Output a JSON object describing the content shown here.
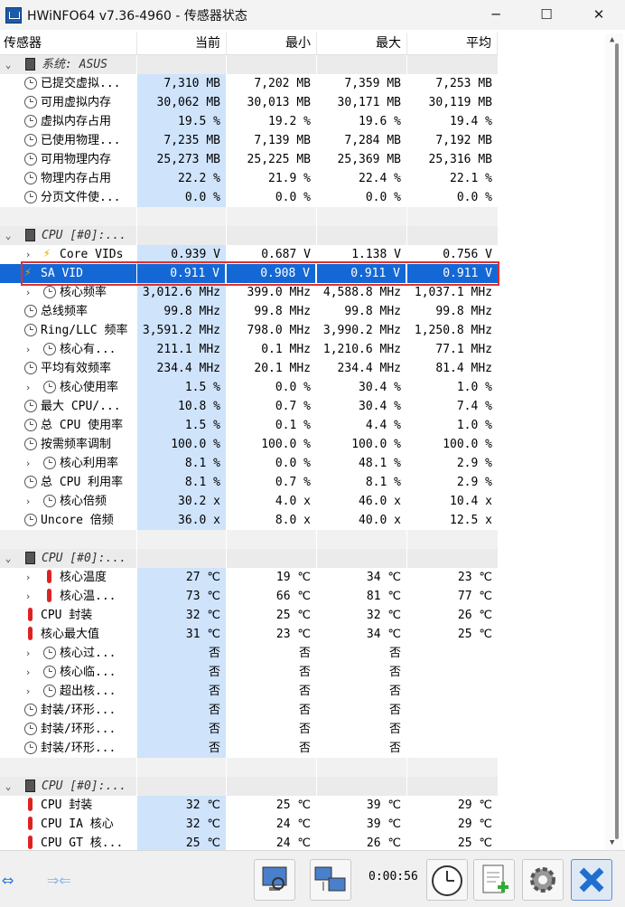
{
  "window": {
    "title": "HWiNFO64 v7.36-4960 - 传感器状态",
    "minimize": "─",
    "maximize": "☐",
    "close": "✕"
  },
  "columns": [
    "传感器",
    "当前",
    "最小",
    "最大",
    "平均"
  ],
  "rows": [
    {
      "type": "group",
      "label": "系统: ASUS",
      "cur": "",
      "min": "",
      "max": "",
      "avg": ""
    },
    {
      "type": "item",
      "icon": "clock",
      "expand": false,
      "label": "已提交虚拟...",
      "cur": "7,310 MB",
      "min": "7,202 MB",
      "max": "7,359 MB",
      "avg": "7,253 MB"
    },
    {
      "type": "item",
      "icon": "clock",
      "expand": false,
      "label": "可用虚拟内存",
      "cur": "30,062 MB",
      "min": "30,013 MB",
      "max": "30,171 MB",
      "avg": "30,119 MB"
    },
    {
      "type": "item",
      "icon": "clock",
      "expand": false,
      "label": "虚拟内存占用",
      "cur": "19.5 %",
      "min": "19.2 %",
      "max": "19.6 %",
      "avg": "19.4 %"
    },
    {
      "type": "item",
      "icon": "clock",
      "expand": false,
      "label": "已使用物理...",
      "cur": "7,235 MB",
      "min": "7,139 MB",
      "max": "7,284 MB",
      "avg": "7,192 MB"
    },
    {
      "type": "item",
      "icon": "clock",
      "expand": false,
      "label": "可用物理内存",
      "cur": "25,273 MB",
      "min": "25,225 MB",
      "max": "25,369 MB",
      "avg": "25,316 MB"
    },
    {
      "type": "item",
      "icon": "clock",
      "expand": false,
      "label": "物理内存占用",
      "cur": "22.2 %",
      "min": "21.9 %",
      "max": "22.4 %",
      "avg": "22.1 %"
    },
    {
      "type": "item",
      "icon": "clock",
      "expand": false,
      "label": "分页文件使...",
      "cur": "0.0 %",
      "min": "0.0 %",
      "max": "0.0 %",
      "avg": "0.0 %"
    },
    {
      "type": "blank"
    },
    {
      "type": "group",
      "label": "CPU [#0]:...",
      "cur": "",
      "min": "",
      "max": "",
      "avg": ""
    },
    {
      "type": "item",
      "icon": "bolt",
      "expand": true,
      "label": "Core VIDs",
      "cur": "0.939 V",
      "min": "0.687 V",
      "max": "1.138 V",
      "avg": "0.756 V"
    },
    {
      "type": "item",
      "icon": "bolt",
      "expand": false,
      "selected": true,
      "label": "SA VID",
      "cur": "0.911 V",
      "min": "0.908 V",
      "max": "0.911 V",
      "avg": "0.911 V"
    },
    {
      "type": "item",
      "icon": "clock",
      "expand": true,
      "label": "核心频率",
      "cur": "3,012.6 MHz",
      "min": "399.0 MHz",
      "max": "4,588.8 MHz",
      "avg": "1,037.1 MHz"
    },
    {
      "type": "item",
      "icon": "clock",
      "expand": false,
      "label": "总线频率",
      "cur": "99.8 MHz",
      "min": "99.8 MHz",
      "max": "99.8 MHz",
      "avg": "99.8 MHz"
    },
    {
      "type": "item",
      "icon": "clock",
      "expand": false,
      "label": "Ring/LLC 频率",
      "cur": "3,591.2 MHz",
      "min": "798.0 MHz",
      "max": "3,990.2 MHz",
      "avg": "1,250.8 MHz"
    },
    {
      "type": "item",
      "icon": "clock",
      "expand": true,
      "label": "核心有...",
      "cur": "211.1 MHz",
      "min": "0.1 MHz",
      "max": "1,210.6 MHz",
      "avg": "77.1 MHz"
    },
    {
      "type": "item",
      "icon": "clock",
      "expand": false,
      "label": "平均有效频率",
      "cur": "234.4 MHz",
      "min": "20.1 MHz",
      "max": "234.4 MHz",
      "avg": "81.4 MHz"
    },
    {
      "type": "item",
      "icon": "clock",
      "expand": true,
      "label": "核心使用率",
      "cur": "1.5 %",
      "min": "0.0 %",
      "max": "30.4 %",
      "avg": "1.0 %"
    },
    {
      "type": "item",
      "icon": "clock",
      "expand": false,
      "label": "最大 CPU/...",
      "cur": "10.8 %",
      "min": "0.7 %",
      "max": "30.4 %",
      "avg": "7.4 %"
    },
    {
      "type": "item",
      "icon": "clock",
      "expand": false,
      "label": "总 CPU 使用率",
      "cur": "1.5 %",
      "min": "0.1 %",
      "max": "4.4 %",
      "avg": "1.0 %"
    },
    {
      "type": "item",
      "icon": "clock",
      "expand": false,
      "label": "按需频率调制",
      "cur": "100.0 %",
      "min": "100.0 %",
      "max": "100.0 %",
      "avg": "100.0 %"
    },
    {
      "type": "item",
      "icon": "clock",
      "expand": true,
      "label": "核心利用率",
      "cur": "8.1 %",
      "min": "0.0 %",
      "max": "48.1 %",
      "avg": "2.9 %"
    },
    {
      "type": "item",
      "icon": "clock",
      "expand": false,
      "label": "总 CPU 利用率",
      "cur": "8.1 %",
      "min": "0.7 %",
      "max": "8.1 %",
      "avg": "2.9 %"
    },
    {
      "type": "item",
      "icon": "clock",
      "expand": true,
      "label": "核心倍频",
      "cur": "30.2 x",
      "min": "4.0 x",
      "max": "46.0 x",
      "avg": "10.4 x"
    },
    {
      "type": "item",
      "icon": "clock",
      "expand": false,
      "label": "Uncore 倍频",
      "cur": "36.0 x",
      "min": "8.0 x",
      "max": "40.0 x",
      "avg": "12.5 x"
    },
    {
      "type": "blank"
    },
    {
      "type": "group",
      "label": "CPU [#0]:...",
      "cur": "",
      "min": "",
      "max": "",
      "avg": ""
    },
    {
      "type": "item",
      "icon": "therm",
      "expand": true,
      "label": "核心温度",
      "cur": "27 ℃",
      "min": "19 ℃",
      "max": "34 ℃",
      "avg": "23 ℃"
    },
    {
      "type": "item",
      "icon": "therm",
      "expand": true,
      "label": "核心温...",
      "cur": "73 ℃",
      "min": "66 ℃",
      "max": "81 ℃",
      "avg": "77 ℃"
    },
    {
      "type": "item",
      "icon": "therm",
      "expand": false,
      "label": "CPU 封装",
      "cur": "32 ℃",
      "min": "25 ℃",
      "max": "32 ℃",
      "avg": "26 ℃"
    },
    {
      "type": "item",
      "icon": "therm",
      "expand": false,
      "label": "核心最大值",
      "cur": "31 ℃",
      "min": "23 ℃",
      "max": "34 ℃",
      "avg": "25 ℃"
    },
    {
      "type": "item",
      "icon": "clock",
      "expand": true,
      "label": "核心过...",
      "cur": "否",
      "min": "否",
      "max": "否",
      "avg": ""
    },
    {
      "type": "item",
      "icon": "clock",
      "expand": true,
      "label": "核心临...",
      "cur": "否",
      "min": "否",
      "max": "否",
      "avg": ""
    },
    {
      "type": "item",
      "icon": "clock",
      "expand": true,
      "label": "超出核...",
      "cur": "否",
      "min": "否",
      "max": "否",
      "avg": ""
    },
    {
      "type": "item",
      "icon": "clock",
      "expand": false,
      "label": "封装/环形...",
      "cur": "否",
      "min": "否",
      "max": "否",
      "avg": ""
    },
    {
      "type": "item",
      "icon": "clock",
      "expand": false,
      "label": "封装/环形...",
      "cur": "否",
      "min": "否",
      "max": "否",
      "avg": ""
    },
    {
      "type": "item",
      "icon": "clock",
      "expand": false,
      "label": "封装/环形...",
      "cur": "否",
      "min": "否",
      "max": "否",
      "avg": ""
    },
    {
      "type": "blank"
    },
    {
      "type": "group",
      "label": "CPU [#0]:...",
      "cur": "",
      "min": "",
      "max": "",
      "avg": ""
    },
    {
      "type": "item",
      "icon": "therm",
      "expand": false,
      "label": "CPU 封装",
      "cur": "32 ℃",
      "min": "25 ℃",
      "max": "39 ℃",
      "avg": "29 ℃"
    },
    {
      "type": "item",
      "icon": "therm",
      "expand": false,
      "label": "CPU IA 核心",
      "cur": "32 ℃",
      "min": "24 ℃",
      "max": "39 ℃",
      "avg": "29 ℃"
    },
    {
      "type": "item",
      "icon": "therm",
      "expand": false,
      "label": "CPU GT 核...",
      "cur": "25 ℃",
      "min": "24 ℃",
      "max": "26 ℃",
      "avg": "25 ℃"
    }
  ],
  "toolbar": {
    "timer": "0:00:56"
  }
}
